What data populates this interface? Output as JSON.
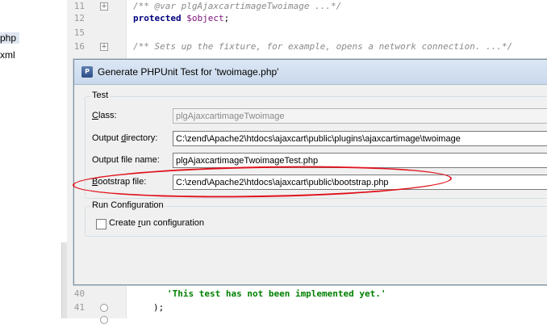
{
  "project_panel": {
    "items": [
      {
        "label": "php",
        "selected": true
      },
      {
        "label": "xml",
        "selected": false
      }
    ]
  },
  "editor": {
    "lines": [
      {
        "num": "11",
        "fold": "plus",
        "segments": [
          {
            "t": "/** @var plgAjaxcartimageTwoimage ...*/",
            "c": "comment"
          }
        ]
      },
      {
        "num": "12",
        "fold": "",
        "segments": [
          {
            "t": "protected ",
            "c": "kw"
          },
          {
            "t": "$object",
            "c": "var"
          },
          {
            "t": ";",
            "c": "norm"
          }
        ]
      },
      {
        "num": "15",
        "fold": "",
        "segments": []
      },
      {
        "num": "16",
        "fold": "plus",
        "segments": [
          {
            "t": "/** Sets up the fixture, for example, opens a network connection. ...*/",
            "c": "comment"
          }
        ]
      }
    ],
    "bottom_lines": [
      {
        "num": "40",
        "fold": "",
        "segments": [
          {
            "t": "'This test has not been implemented yet.'",
            "c": "str"
          }
        ]
      },
      {
        "num": "41",
        "fold": "round",
        "segments": [
          {
            "t": ");",
            "c": "norm"
          }
        ]
      }
    ]
  },
  "dialog": {
    "title": "Generate PHPUnit Test for 'twoimage.php'",
    "icon_text": "P",
    "test_group_label": "Test",
    "class_label_ul": "C",
    "class_label_rest": "lass:",
    "class_value": "plgAjaxcartimageTwoimage",
    "outdir_label_pre": "Output ",
    "outdir_label_ul": "d",
    "outdir_label_rest": "irectory:",
    "outdir_value": "C:\\zend\\Apache2\\htdocs\\ajaxcart\\public\\plugins\\ajaxcartimage\\twoimage",
    "outfile_label": "Output file name:",
    "outfile_value": "plgAjaxcartimageTwoimageTest.php",
    "bootstrap_label_ul": "B",
    "bootstrap_label_rest": "ootstrap file:",
    "bootstrap_value": "C:\\zend\\Apache2\\htdocs\\ajaxcart\\public\\bootstrap.php",
    "run_group_label": "Run Configuration",
    "create_run_pre": "Create ",
    "create_run_ul": "r",
    "create_run_rest": "un configuration",
    "create_run_checked": false
  },
  "colors": {
    "annotation": "#e0121c",
    "comment": "#8a8a8a",
    "keyword": "#000080",
    "variable": "#7a0f7a",
    "string": "#008000"
  }
}
